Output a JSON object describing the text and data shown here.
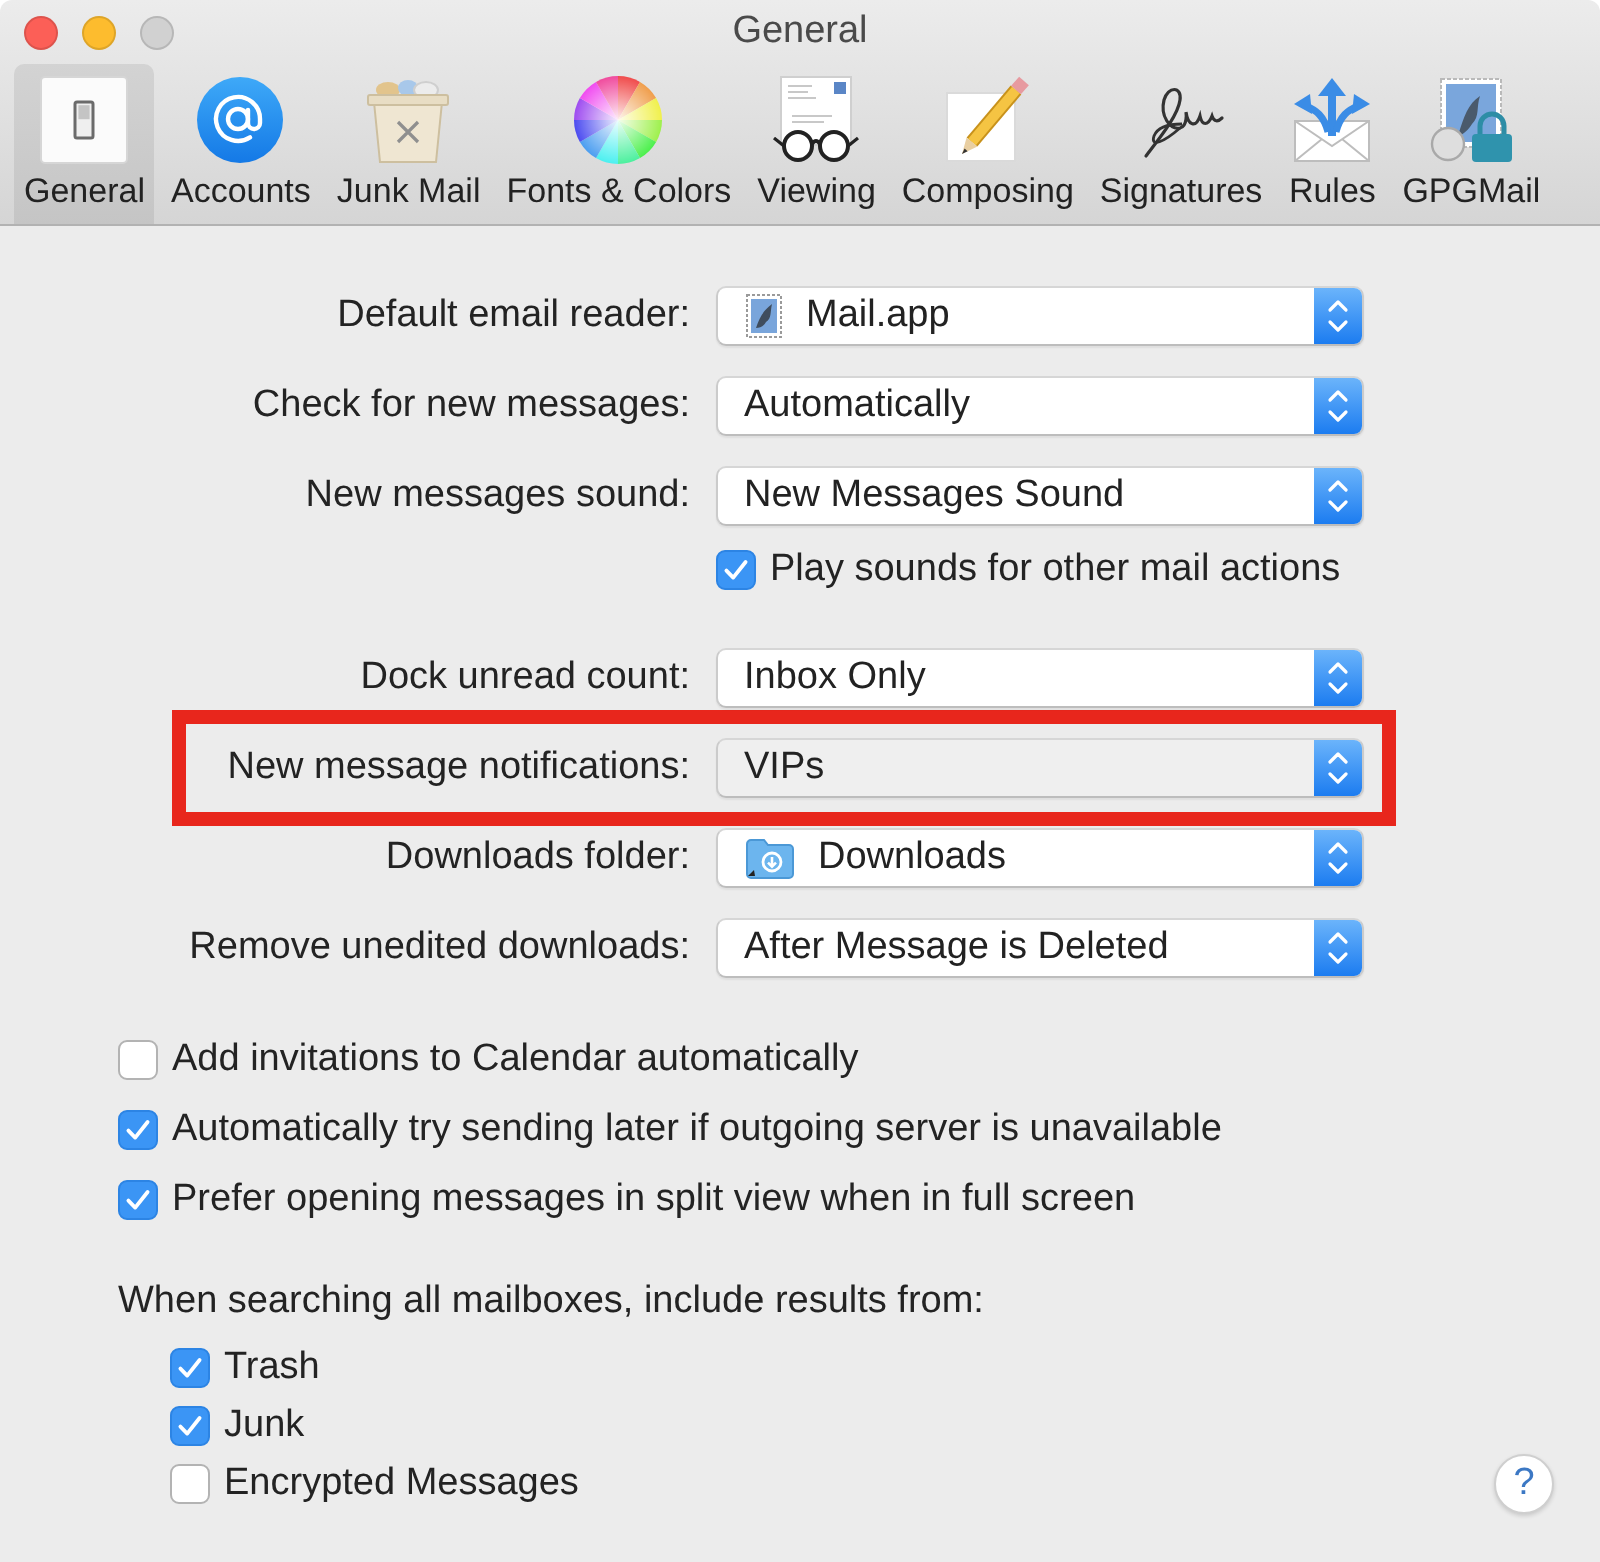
{
  "window": {
    "title": "General",
    "controls": [
      {
        "kind": "close",
        "disabled": false
      },
      {
        "kind": "minimize",
        "disabled": false
      },
      {
        "kind": "zoom",
        "disabled": true
      }
    ]
  },
  "toolbar": [
    {
      "label": "General",
      "selected": true
    },
    {
      "label": "Accounts",
      "selected": false
    },
    {
      "label": "Junk Mail",
      "selected": false
    },
    {
      "label": "Fonts & Colors",
      "selected": false
    },
    {
      "label": "Viewing",
      "selected": false
    },
    {
      "label": "Composing",
      "selected": false
    },
    {
      "label": "Signatures",
      "selected": false
    },
    {
      "label": "Rules",
      "selected": false
    },
    {
      "label": "GPGMail",
      "selected": false
    }
  ],
  "form": {
    "rows": [
      {
        "kind": "app",
        "label": "Default email reader:",
        "value": "Mail.app",
        "highlighted": false
      },
      {
        "kind": "popup",
        "label": "Check for new messages:",
        "value": "Automatically",
        "highlighted": false
      },
      {
        "kind": "popup",
        "label": "New messages sound:",
        "value": "New Messages Sound",
        "highlighted": false
      },
      {
        "kind": "checkbox",
        "label": "Play sounds for other mail actions",
        "checked": true
      },
      {
        "kind": "popup",
        "label": "Dock unread count:",
        "value": "Inbox Only",
        "highlighted": false
      },
      {
        "kind": "popup",
        "label": "New message notifications:",
        "value": "VIPs",
        "highlighted": true
      },
      {
        "kind": "folder",
        "label": "Downloads folder:",
        "value": "Downloads",
        "highlighted": false
      },
      {
        "kind": "popup",
        "label": "Remove unedited downloads:",
        "value": "After Message is Deleted",
        "highlighted": false
      }
    ]
  },
  "options": [
    {
      "label": "Add invitations to Calendar automatically",
      "checked": false
    },
    {
      "label": "Automatically try sending later if outgoing server is unavailable",
      "checked": true
    },
    {
      "label": "Prefer opening messages in split view when in full screen",
      "checked": true
    }
  ],
  "search_scope": {
    "label": "When searching all mailboxes, include results from:",
    "items": [
      {
        "label": "Trash",
        "checked": true
      },
      {
        "label": "Junk",
        "checked": true
      },
      {
        "label": "Encrypted Messages",
        "checked": false
      }
    ]
  },
  "help_button": "?"
}
